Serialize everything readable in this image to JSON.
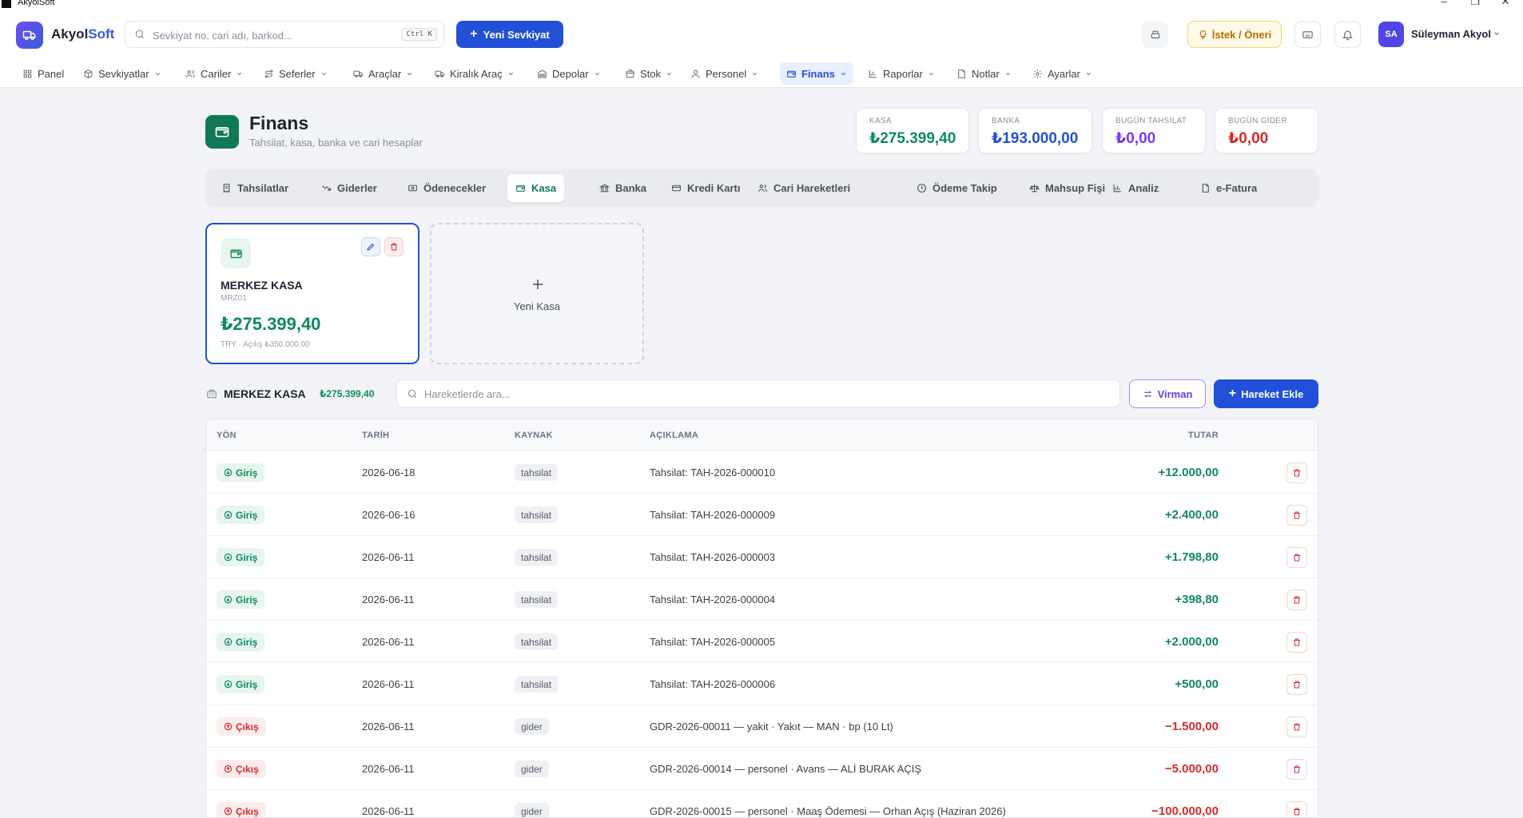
{
  "window": {
    "title": "AkyolSoft"
  },
  "brand": {
    "name_main": "Akyol",
    "name_accent": "Soft"
  },
  "search": {
    "placeholder": "Sevkiyat no, cari adı, barkod...",
    "shortcut": "Ctrl K"
  },
  "top_actions": {
    "new_shipment": "Yeni Sevkiyat",
    "suggestion": "İstek / Öneri"
  },
  "user": {
    "initials": "SA",
    "name": "Süleyman Akyol"
  },
  "nav": [
    {
      "label": "Panel",
      "icon": "grid-icon"
    },
    {
      "label": "Sevkiyatlar",
      "icon": "package-icon"
    },
    {
      "label": "Cariler",
      "icon": "users-icon"
    },
    {
      "label": "Seferler",
      "icon": "route-icon"
    },
    {
      "label": "Araçlar",
      "icon": "truck-icon"
    },
    {
      "label": "Kiralık Araç",
      "icon": "truck-icon"
    },
    {
      "label": "Depolar",
      "icon": "warehouse-icon"
    },
    {
      "label": "Stok",
      "icon": "box-icon"
    },
    {
      "label": "Personel",
      "icon": "user-icon"
    },
    {
      "label": "Finans",
      "icon": "wallet-icon",
      "active": true
    },
    {
      "label": "Raporlar",
      "icon": "bar-chart-icon"
    },
    {
      "label": "Notlar",
      "icon": "note-icon"
    },
    {
      "label": "Ayarlar",
      "icon": "gear-icon"
    }
  ],
  "page": {
    "title": "Finans",
    "subtitle": "Tahsilat, kasa, banka ve cari hesaplar"
  },
  "stats": [
    {
      "label": "KASA",
      "value": "₺275.399,40",
      "color": "#0f8a5a"
    },
    {
      "label": "BANKA",
      "value": "₺193.000,00",
      "color": "#2250d8"
    },
    {
      "label": "BUGÜN TAHSİLAT",
      "value": "₺0,00",
      "color": "#7c3aed"
    },
    {
      "label": "BUGÜN GİDER",
      "value": "₺0,00",
      "color": "#d62a2a"
    }
  ],
  "tabs": [
    {
      "label": "Tahsilatlar",
      "icon": "receipt-icon"
    },
    {
      "label": "Giderler",
      "icon": "trending-down-icon"
    },
    {
      "label": "Ödenecekler",
      "icon": "money-icon"
    },
    {
      "label": "Kasa",
      "icon": "wallet-icon",
      "active": true
    },
    {
      "label": "Banka",
      "icon": "bank-icon"
    },
    {
      "label": "Kredi Kartı",
      "icon": "credit-card-icon"
    },
    {
      "label": "Cari Hareketleri",
      "icon": "users-icon"
    },
    {
      "label": "Ödeme Takip",
      "icon": "clock-icon"
    },
    {
      "label": "Mahsup Fişi",
      "icon": "scale-icon"
    },
    {
      "label": "Analiz",
      "icon": "bar-chart-icon"
    },
    {
      "label": "e-Fatura",
      "icon": "file-icon"
    }
  ],
  "kasa_card": {
    "name": "MERKEZ KASA",
    "code": "MRZ01",
    "balance": "₺275.399,40",
    "meta": "TRY · Açılış ₺350.000,00"
  },
  "new_kasa": {
    "label": "Yeni Kasa"
  },
  "selected_kasa": {
    "name": "MERKEZ KASA",
    "balance": "₺275.399,40"
  },
  "tx_search": {
    "placeholder": "Hareketlerde ara..."
  },
  "tx_actions": {
    "virman": "Virman",
    "add": "Hareket Ekle"
  },
  "table": {
    "headers": {
      "dir": "YÖN",
      "date": "TARİH",
      "source": "KAYNAK",
      "desc": "AÇIKLAMA",
      "amount": "TUTAR"
    },
    "rows": [
      {
        "dir": "Giriş",
        "type": "in",
        "date": "2026-06-18",
        "source": "tahsilat",
        "desc": "Tahsilat: TAH-2026-000010",
        "amount": "+12.000,00"
      },
      {
        "dir": "Giriş",
        "type": "in",
        "date": "2026-06-16",
        "source": "tahsilat",
        "desc": "Tahsilat: TAH-2026-000009",
        "amount": "+2.400,00"
      },
      {
        "dir": "Giriş",
        "type": "in",
        "date": "2026-06-11",
        "source": "tahsilat",
        "desc": "Tahsilat: TAH-2026-000003",
        "amount": "+1.798,80"
      },
      {
        "dir": "Giriş",
        "type": "in",
        "date": "2026-06-11",
        "source": "tahsilat",
        "desc": "Tahsilat: TAH-2026-000004",
        "amount": "+398,80"
      },
      {
        "dir": "Giriş",
        "type": "in",
        "date": "2026-06-11",
        "source": "tahsilat",
        "desc": "Tahsilat: TAH-2026-000005",
        "amount": "+2.000,00"
      },
      {
        "dir": "Giriş",
        "type": "in",
        "date": "2026-06-11",
        "source": "tahsilat",
        "desc": "Tahsilat: TAH-2026-000006",
        "amount": "+500,00"
      },
      {
        "dir": "Çıkış",
        "type": "out",
        "date": "2026-06-11",
        "source": "gider",
        "desc": "GDR-2026-00011 — yakit · Yakıt — MAN · bp (10 Lt)",
        "amount": "−1.500,00"
      },
      {
        "dir": "Çıkış",
        "type": "out",
        "date": "2026-06-11",
        "source": "gider",
        "desc": "GDR-2026-00014 — personel · Avans — ALİ BURAK AÇIŞ",
        "amount": "−5.000,00"
      },
      {
        "dir": "Çıkış",
        "type": "out",
        "date": "2026-06-11",
        "source": "gider",
        "desc": "GDR-2026-00015 — personel · Maaş Ödemesi — Orhan Açış (Haziran 2026)",
        "amount": "−100.000,00"
      }
    ]
  }
}
